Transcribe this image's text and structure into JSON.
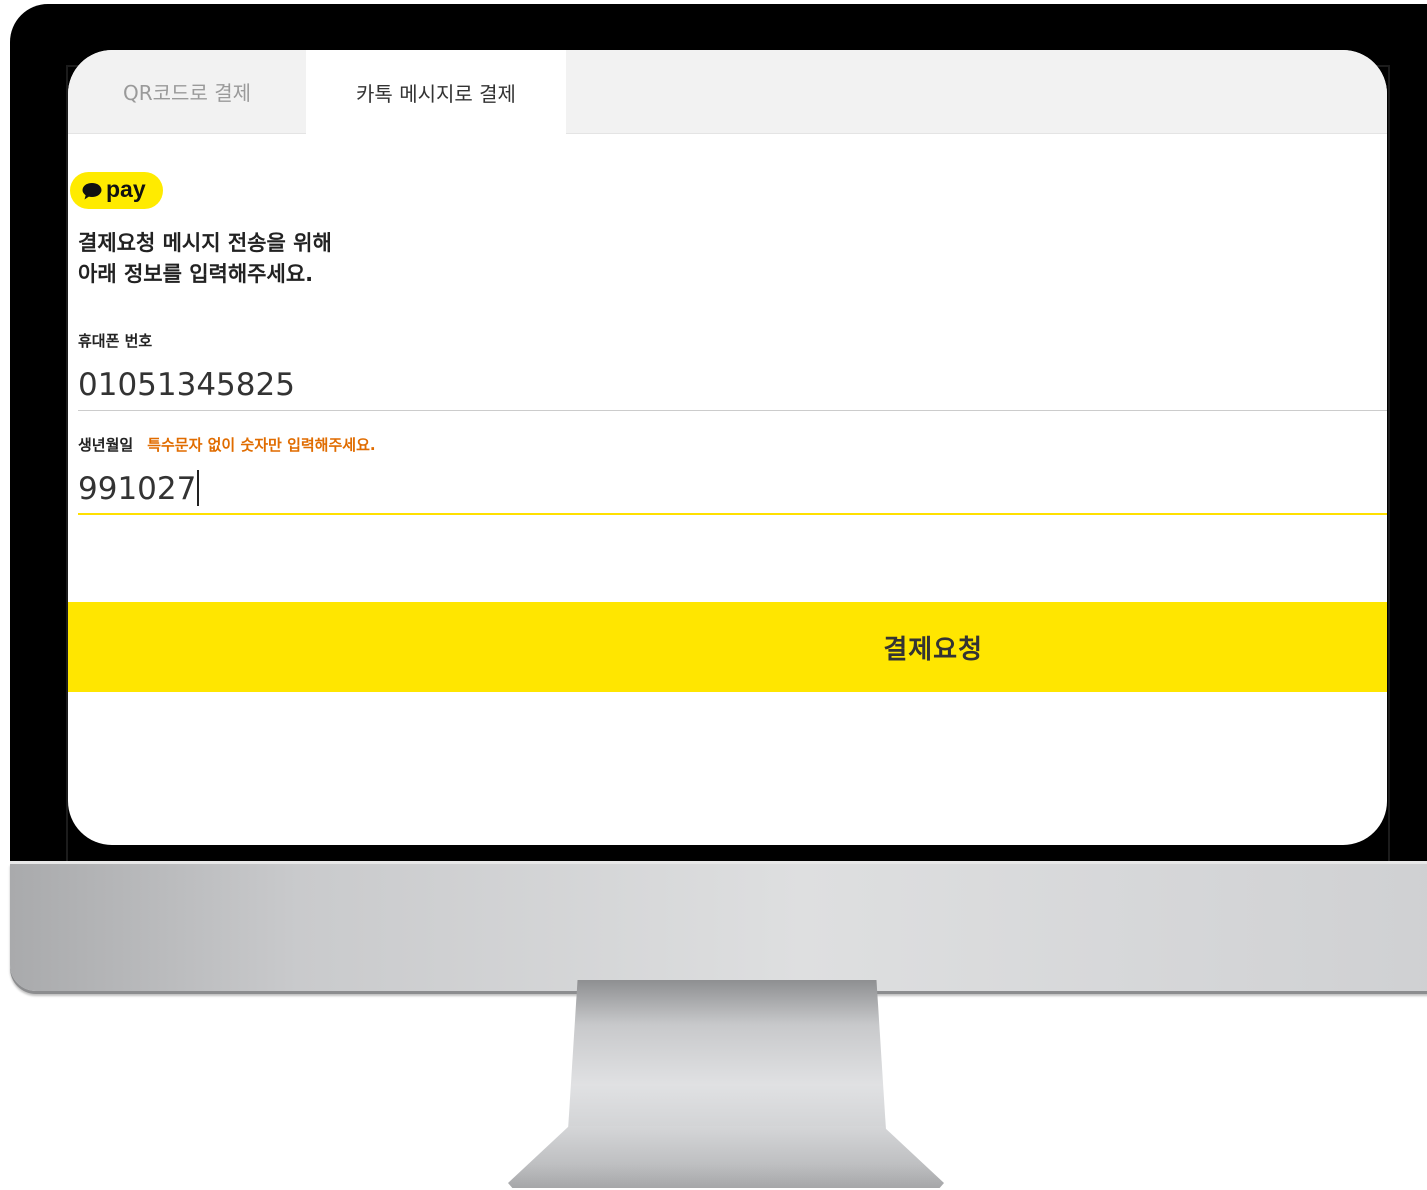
{
  "tabs": [
    {
      "label": "QR코드로 결제",
      "active": false
    },
    {
      "label": "카톡 메시지로 결제",
      "active": true
    }
  ],
  "badge": {
    "text": "pay",
    "icon": "speech-bubble-icon",
    "color": "#ffeb00"
  },
  "heading": {
    "line1": "결제요청 메시지 전송을 위해",
    "line2": "아래 정보를 입력해주세요."
  },
  "phone": {
    "label": "휴대폰 번호",
    "value": "01051345825"
  },
  "birth": {
    "label": "생년월일",
    "hint": "특수문자 없이 숫자만 입력해주세요.",
    "value": "991027"
  },
  "submit": {
    "label": "결제요청",
    "color": "#ffe600"
  },
  "colors": {
    "accent": "#ffe600",
    "hint": "#e06c00",
    "bezel": "#000000"
  }
}
